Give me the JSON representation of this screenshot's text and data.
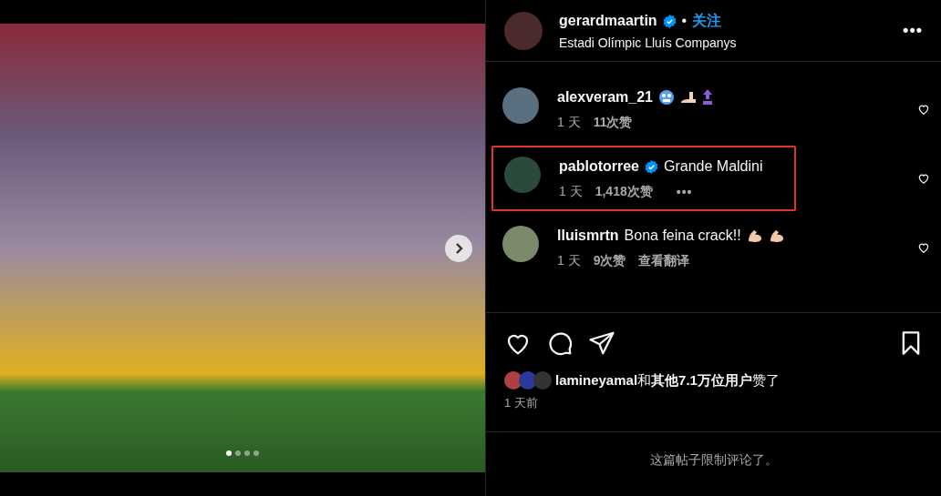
{
  "post_photo": {
    "slides": [
      {
        "selected": true
      },
      {
        "selected": false
      },
      {
        "selected": false
      },
      {
        "selected": false
      }
    ]
  },
  "header": {
    "username": "gerardmaartin",
    "verified": true,
    "separator": "•",
    "follow": "关注",
    "location": "Estadi Olímpic Lluís Companys",
    "options": "•••"
  },
  "comments": [
    {
      "username": "alexveram_21",
      "verified": false,
      "emojis": [
        {
          "kind": "cold-face"
        },
        {
          "kind": "foot"
        },
        {
          "kind": "top"
        }
      ],
      "time": "1 天",
      "likes": "11次赞",
      "highlighted": false
    },
    {
      "username": "pablotorree",
      "verified": true,
      "text": "Grande Maldini",
      "time": "1 天",
      "likes": "1,418次赞",
      "options": "•••",
      "highlighted": true
    },
    {
      "username": "lluismrtn",
      "verified": false,
      "text": "Bona feina crack!!",
      "emojis": [
        {
          "kind": "flexed-arm"
        },
        {
          "kind": "flexed-arm"
        }
      ],
      "time": "1 天",
      "likes": "9次赞",
      "extra": "查看翻译",
      "highlighted": false
    }
  ],
  "likes_summary": {
    "user": "lamineyamal",
    "joiner": "和",
    "others": "其他7.1万位用户",
    "suffix": "赞了"
  },
  "posted": "1 天前",
  "footer": "这篇帖子限制评论了。"
}
